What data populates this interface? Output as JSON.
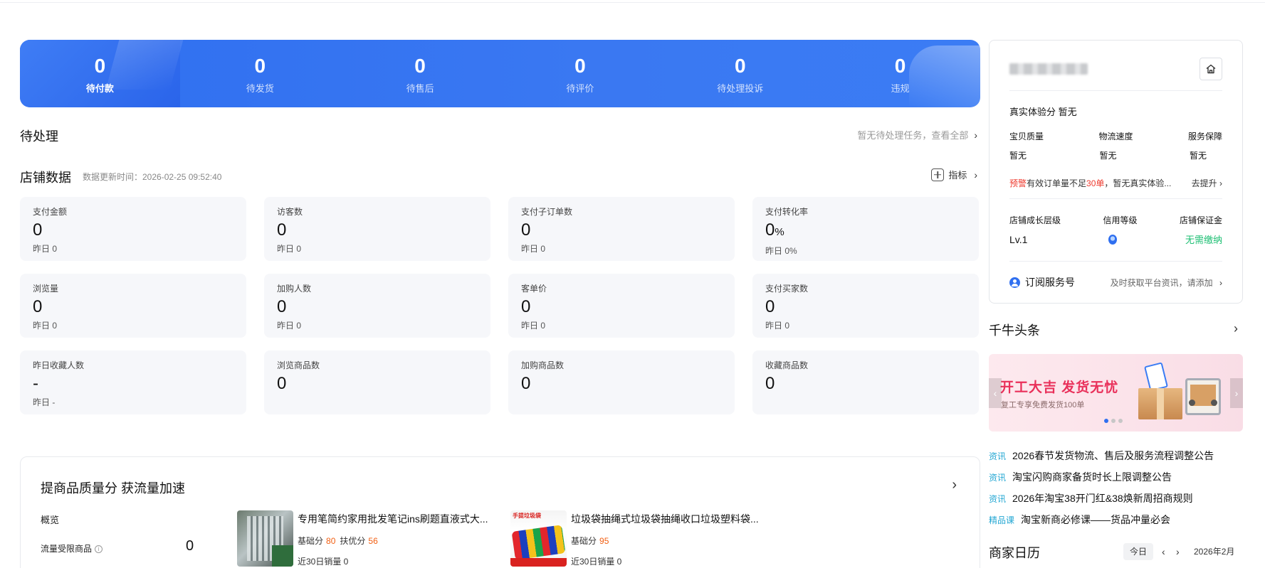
{
  "order_status": [
    {
      "count": "0",
      "label": "待付款"
    },
    {
      "count": "0",
      "label": "待发货"
    },
    {
      "count": "0",
      "label": "待售后"
    },
    {
      "count": "0",
      "label": "待评价"
    },
    {
      "count": "0",
      "label": "待处理投诉"
    },
    {
      "count": "0",
      "label": "违规"
    }
  ],
  "pending": {
    "title": "待处理",
    "link": "暂无待处理任务，查看全部",
    "chevron": "›"
  },
  "shop_data": {
    "title": "店铺数据",
    "update_time": "数据更新时间：2026-02-25 09:52:40",
    "indicator_label": "指标",
    "metrics": [
      {
        "label": "支付金额",
        "value": "0",
        "sub": "昨日 0"
      },
      {
        "label": "访客数",
        "value": "0",
        "sub": "昨日 0"
      },
      {
        "label": "支付子订单数",
        "value": "0",
        "sub": "昨日 0"
      },
      {
        "label": "支付转化率",
        "value": "0",
        "unit": "%",
        "sub": "昨日 0%"
      },
      {
        "label": "浏览量",
        "value": "0",
        "sub": "昨日 0"
      },
      {
        "label": "加购人数",
        "value": "0",
        "sub": "昨日 0"
      },
      {
        "label": "客单价",
        "value": "0",
        "sub": "昨日 0"
      },
      {
        "label": "支付买家数",
        "value": "0",
        "sub": "昨日 0"
      },
      {
        "label": "昨日收藏人数",
        "value": "-",
        "sub": "昨日 -"
      },
      {
        "label": "浏览商品数",
        "value": "0",
        "sub": ""
      },
      {
        "label": "加购商品数",
        "value": "0",
        "sub": ""
      },
      {
        "label": "收藏商品数",
        "value": "0",
        "sub": ""
      }
    ]
  },
  "quality": {
    "title": "提商品质量分 获流量加速",
    "overview_label": "概览",
    "flow_limited_label": "流量受限商品",
    "flow_limited_value": "0",
    "products": [
      {
        "title": "专用笔简约家用批发笔记ins刷题直液式大...",
        "base_label": "基础分",
        "base_score": "80",
        "support_label": "扶优分",
        "support_score": "56",
        "sales": "近30日销量 0"
      },
      {
        "title": "垃圾袋抽绳式垃圾袋抽绳收口垃圾塑料袋...",
        "base_label": "基础分",
        "base_score": "95",
        "support_label": "",
        "support_score": "",
        "sales": "近30日销量 0",
        "thumb_tag": "手提垃圾袋"
      }
    ]
  },
  "shop_card": {
    "experience_label": "真实体验分",
    "experience_value": "暂无",
    "scores": [
      {
        "label": "宝贝质量",
        "value": "暂无"
      },
      {
        "label": "物流速度",
        "value": "暂无"
      },
      {
        "label": "服务保障",
        "value": "暂无"
      }
    ],
    "warning_tag": "预警",
    "warning_text_a": "有效订单量不足",
    "warning_count": "30单",
    "warning_text_b": "，暂无真实体验...",
    "warning_action": "去提升",
    "growth_label": "店铺成长层级",
    "credit_label": "信用等级",
    "deposit_label": "店铺保证金",
    "growth_value": "Lv.1",
    "deposit_value": "无需缴纳",
    "subscribe_label": "订阅服务号",
    "subscribe_desc": "及时获取平台资讯，请添加"
  },
  "news": {
    "title": "千牛头条",
    "banner_title": "开工大吉 发货无忧",
    "banner_sub": "复工专享免费发货100单",
    "items": [
      {
        "tag": "资讯",
        "text": "2026春节发货物流、售后及服务流程调整公告"
      },
      {
        "tag": "资讯",
        "text": "淘宝闪购商家备货时长上限调整公告"
      },
      {
        "tag": "资讯",
        "text": "2026年淘宝38开门红&38焕新周招商规则"
      },
      {
        "tag": "精品课",
        "text": "淘宝新商必修课——货品冲量必会"
      }
    ]
  },
  "calendar": {
    "title": "商家日历",
    "today_label": "今日",
    "prev": "‹",
    "next": "›",
    "month": "2026年2月"
  },
  "colors": {
    "brand_blue": "#2f6ff0",
    "score_orange": "#f25f12",
    "warning_red": "#ee3a2e",
    "success_green": "#1dbf73",
    "tag_cyan": "#23a7d3",
    "banner_pink": "#e9305a"
  },
  "icons": {
    "home": "home-icon",
    "plus": "plus-square-icon",
    "chevron": "chevron-right-icon",
    "info": "info-circle-icon",
    "medal": "credit-medal-icon",
    "user": "user-circle-icon"
  }
}
